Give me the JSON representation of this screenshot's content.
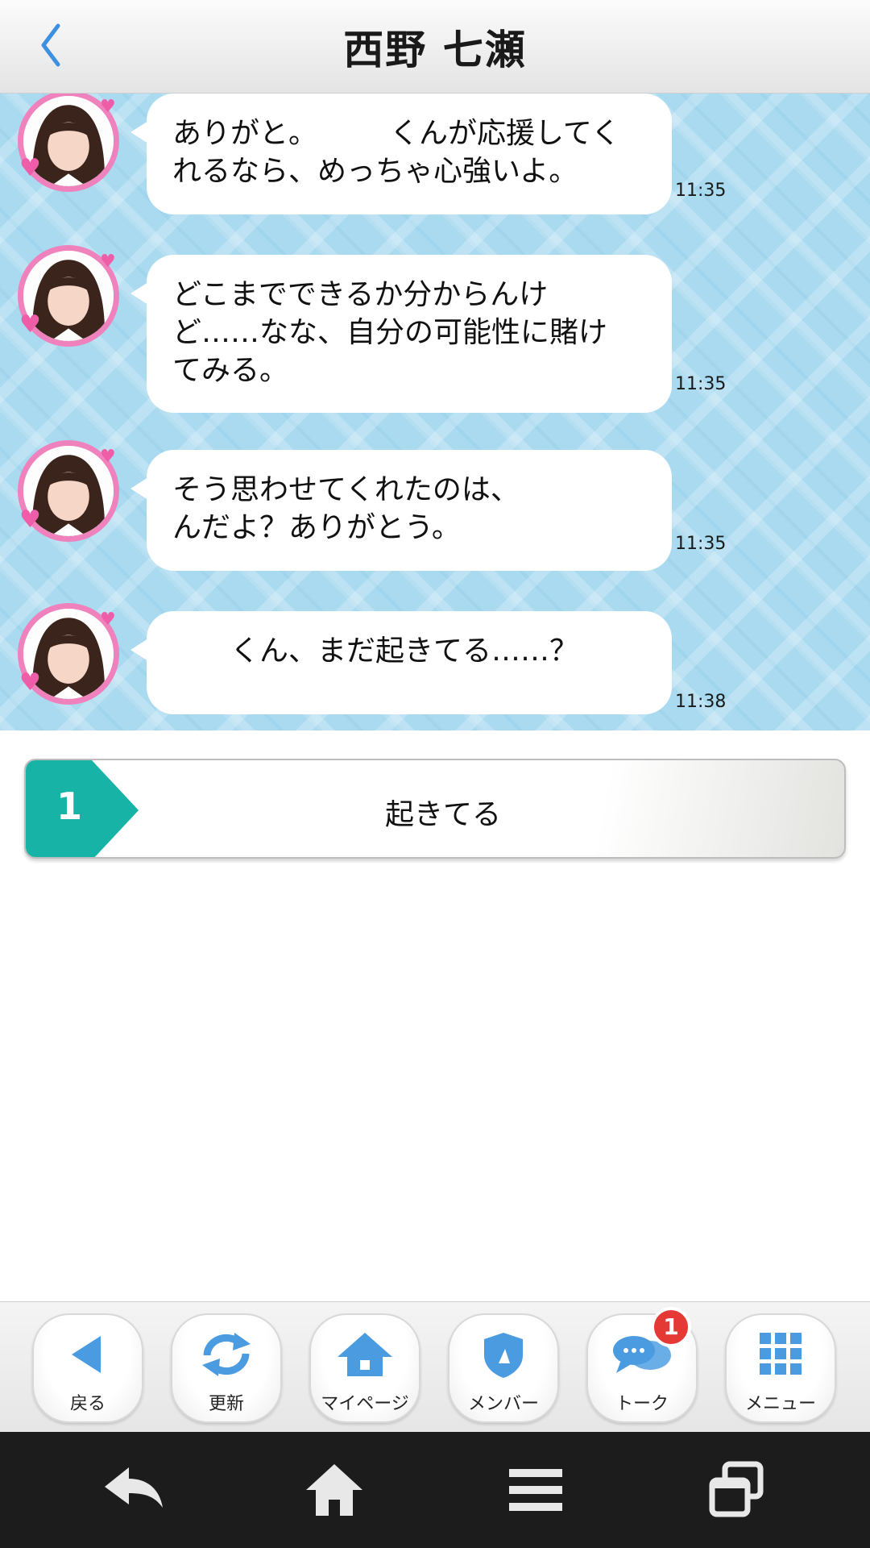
{
  "header": {
    "title": "西野 七瀬"
  },
  "messages": [
    {
      "lines": [
        "ありがと。　　　くんが応援してく",
        "れるなら、めっちゃ心強いよ。"
      ],
      "time": "11:35"
    },
    {
      "lines": [
        "どこまでできるか分からんけ",
        "ど……なな、自分の可能性に賭け",
        "てみる。"
      ],
      "time": "11:35"
    },
    {
      "lines": [
        "そう思わせてくれたのは、",
        "んだよ？ありがとう。"
      ],
      "time": "11:35"
    },
    {
      "lines": [
        "　　くん、まだ起きてる……？"
      ],
      "time": "11:38"
    }
  ],
  "choice": {
    "number": "1",
    "label": "起きてる"
  },
  "toolbar": {
    "items": [
      {
        "label": "戻る",
        "icon": "back-arrow-icon"
      },
      {
        "label": "更新",
        "icon": "refresh-icon"
      },
      {
        "label": "マイページ",
        "icon": "home-icon"
      },
      {
        "label": "メンバー",
        "icon": "shield-icon"
      },
      {
        "label": "トーク",
        "icon": "chat-bubbles-icon",
        "badge": "1"
      },
      {
        "label": "メニュー",
        "icon": "grid-icon"
      }
    ]
  },
  "colors": {
    "accent_blue": "#4a9be0",
    "chat_bg": "#a9daf0",
    "avatar_ring": "#ef82bd",
    "choice_teal": "#17b3a6",
    "badge_red": "#e53935"
  }
}
